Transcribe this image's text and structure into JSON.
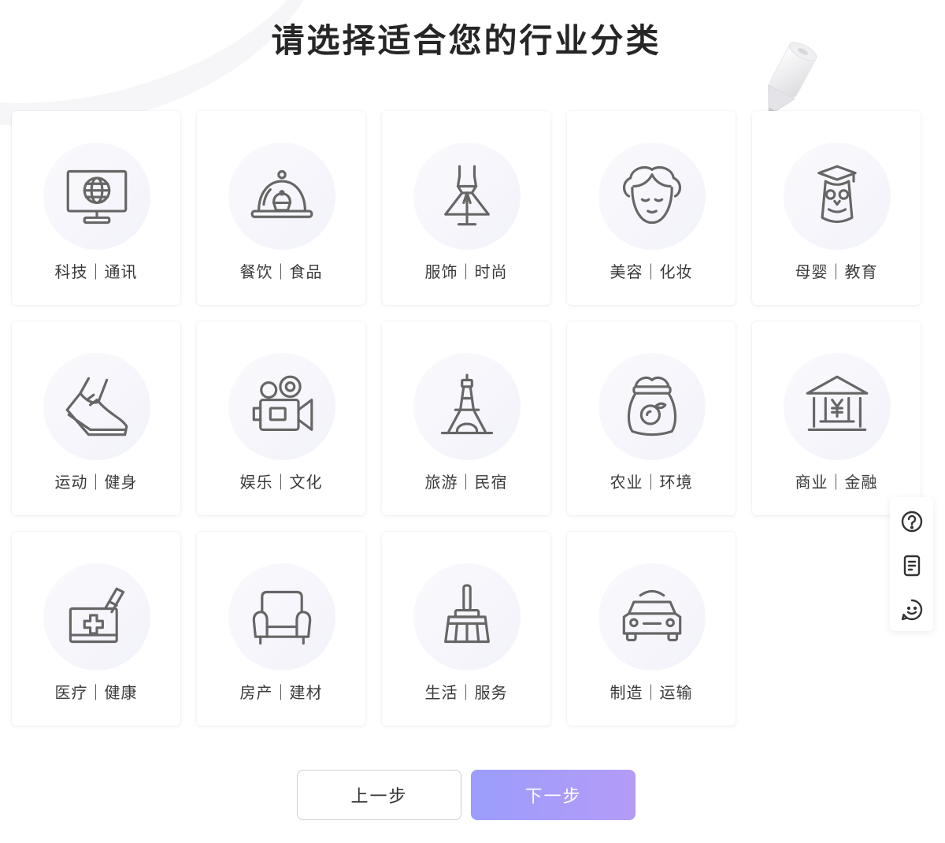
{
  "page": {
    "title": "请选择适合您的行业分类"
  },
  "categories": [
    {
      "label": "科技｜通讯",
      "icon": "monitor-globe-icon"
    },
    {
      "label": "餐饮｜食品",
      "icon": "food-cloche-icon"
    },
    {
      "label": "服饰｜时尚",
      "icon": "dress-mannequin-icon"
    },
    {
      "label": "美容｜化妆",
      "icon": "woman-face-icon"
    },
    {
      "label": "母婴｜教育",
      "icon": "graduate-owl-icon"
    },
    {
      "label": "运动｜健身",
      "icon": "sneaker-icon"
    },
    {
      "label": "娱乐｜文化",
      "icon": "video-camera-icon"
    },
    {
      "label": "旅游｜民宿",
      "icon": "eiffel-tower-icon"
    },
    {
      "label": "农业｜环境",
      "icon": "produce-sack-icon"
    },
    {
      "label": "商业｜金融",
      "icon": "bank-yuan-icon"
    },
    {
      "label": "医疗｜健康",
      "icon": "medical-kit-icon"
    },
    {
      "label": "房产｜建材",
      "icon": "armchair-icon"
    },
    {
      "label": "生活｜服务",
      "icon": "broom-icon"
    },
    {
      "label": "制造｜运输",
      "icon": "car-icon"
    }
  ],
  "side_tools": [
    {
      "icon": "help-circle-icon"
    },
    {
      "icon": "document-icon"
    },
    {
      "icon": "smiley-icon"
    }
  ],
  "buttons": {
    "prev": "上一步",
    "next": "下一步"
  },
  "colors": {
    "accent_start": "#9b9dfc",
    "accent_end": "#b49bf7",
    "icon_stroke": "#666666"
  }
}
